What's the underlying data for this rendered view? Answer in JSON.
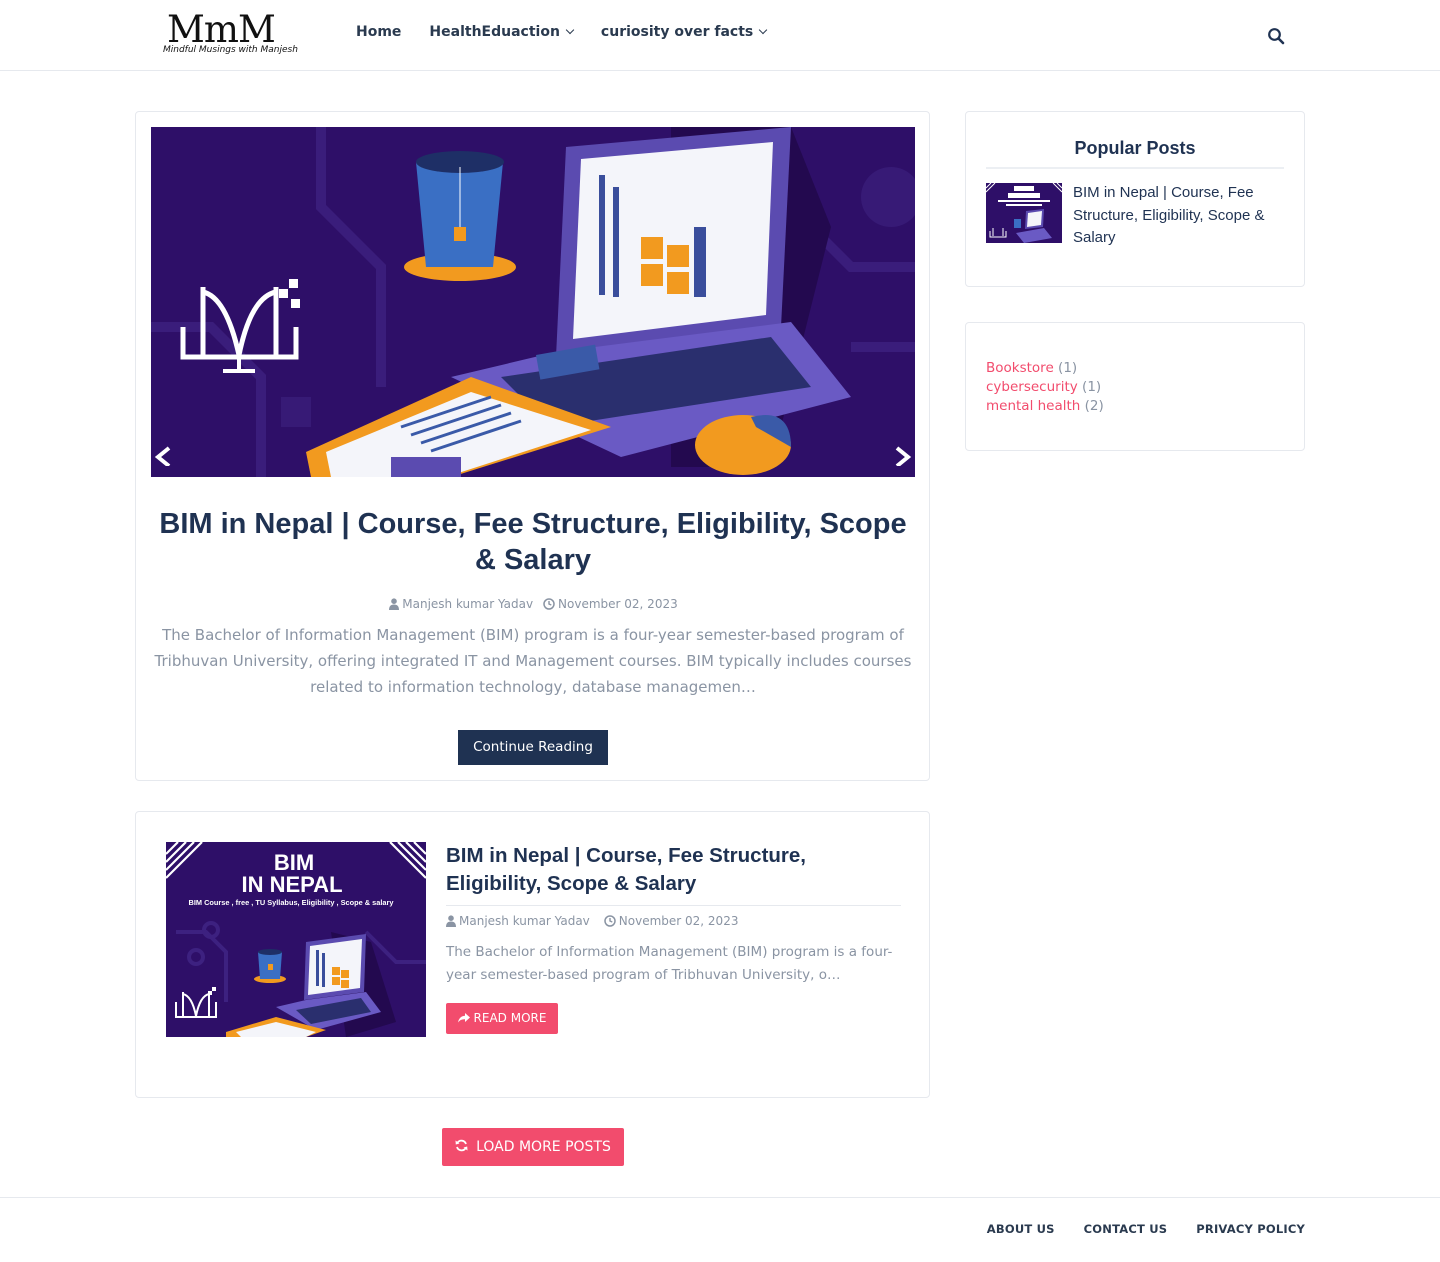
{
  "header": {
    "logo_main": "MmM",
    "logo_tagline": "Mindful Musings with Manjesh",
    "nav": [
      {
        "label": "Home"
      },
      {
        "label": "HealthEduaction"
      },
      {
        "label": "curiosity over facts"
      }
    ],
    "search_icon": "search-icon"
  },
  "featured": {
    "title": "BIM in Nepal | Course, Fee Structure, Eligibility, Scope & Salary",
    "author": "Manjesh kumar Yadav",
    "date": "November 02, 2023",
    "excerpt": "The Bachelor of Information Management (BIM) program is a four-year semester-based program of Tribhuvan University, offering integrated IT and Management courses. BIM typically includes courses related to information technology, database managemen…",
    "button": "Continue Reading"
  },
  "post": {
    "thumb_title_line1": "BIM",
    "thumb_title_line2": "IN NEPAL",
    "thumb_subtitle": "BIM Course , free , TU Syllabus, Eligibility , Scope & salary",
    "title": "BIM in Nepal | Course, Fee Structure, Eligibility, Scope & Salary",
    "author": "Manjesh kumar Yadav",
    "date": "November 02, 2023",
    "excerpt": "The Bachelor of Information Management (BIM) program is a four-year semester-based program of Tribhuvan University, o…",
    "button": "READ MORE"
  },
  "load_more": "LOAD MORE POSTS",
  "sidebar": {
    "popular_title": "Popular Posts",
    "popular_post": "BIM in Nepal | Course, Fee Structure, Eligibility, Scope & Salary",
    "labels": [
      {
        "name": "Bookstore",
        "count": "(1)"
      },
      {
        "name": "cybersecurity",
        "count": "(1)"
      },
      {
        "name": "mental health",
        "count": "(2)"
      }
    ]
  },
  "footer": {
    "links": [
      "ABOUT US",
      "CONTACT US",
      "PRIVACY POLICY"
    ]
  },
  "colors": {
    "accent": "#f24c6d",
    "navy": "#1f3252",
    "hero_bg": "#2e0f68"
  }
}
